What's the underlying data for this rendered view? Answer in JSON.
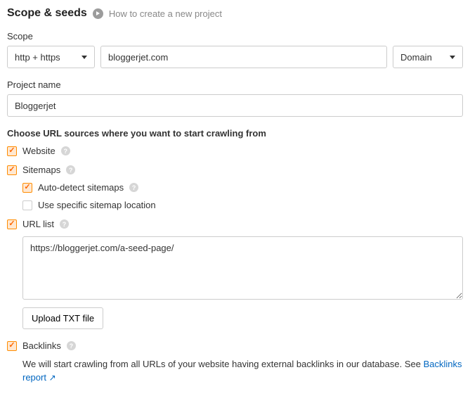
{
  "header": {
    "title": "Scope & seeds",
    "help_link": "How to create a new project"
  },
  "scope": {
    "label": "Scope",
    "protocol": "http + https",
    "domain_input": "bloggerjet.com",
    "mode": "Domain"
  },
  "project": {
    "label": "Project name",
    "value": "Bloggerjet"
  },
  "sources": {
    "heading": "Choose URL sources where you want to start crawling from",
    "website": {
      "label": "Website",
      "checked": true
    },
    "sitemaps": {
      "label": "Sitemaps",
      "checked": true,
      "auto": {
        "label": "Auto-detect sitemaps",
        "checked": true
      },
      "specific": {
        "label": "Use specific sitemap location",
        "checked": false
      }
    },
    "urllist": {
      "label": "URL list",
      "checked": true,
      "textarea": "https://bloggerjet.com/a-seed-page/",
      "upload_btn": "Upload TXT file"
    },
    "backlinks": {
      "label": "Backlinks",
      "checked": true,
      "desc_prefix": "We will start crawling from all URLs of your website having external backlinks in our database. See ",
      "link_text": "Backlinks report"
    }
  }
}
